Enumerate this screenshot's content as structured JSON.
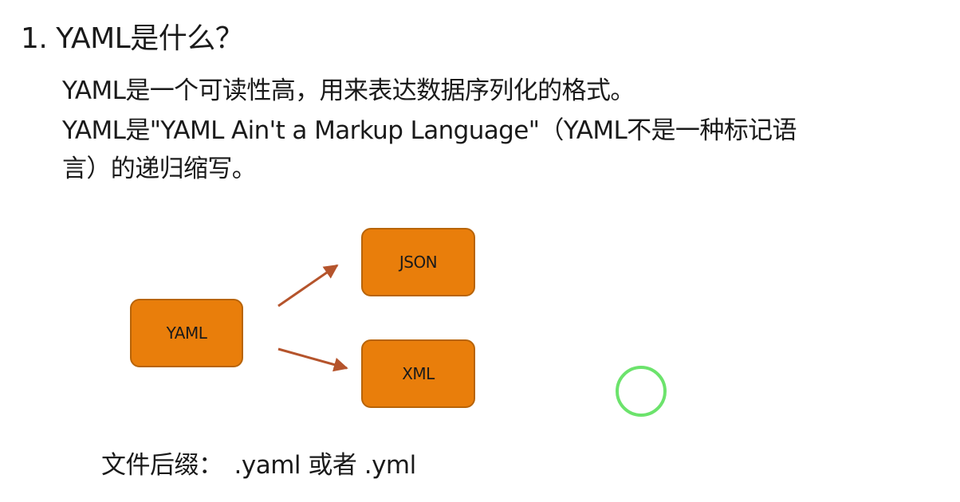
{
  "slide": {
    "title": "1. YAML是什么？",
    "paragraph_line1": "YAML是一个可读性高，用来表达数据序列化的格式。",
    "paragraph_line2": "YAML是\"YAML Ain't a Markup Language\"（YAML不是一种标记语",
    "paragraph_line3": "言）的递归缩写。",
    "diagram": {
      "source_label": "YAML",
      "target_top_label": "JSON",
      "target_bottom_label": "XML",
      "box_color": "#E97E0B",
      "arrow_color": "#B5542C"
    },
    "suffix_label": "文件后缀：",
    "suffix_values": ".yaml 或者 .yml"
  },
  "cursor": {
    "icon": "cursor-ring-icon",
    "color": "#6CE36C"
  }
}
